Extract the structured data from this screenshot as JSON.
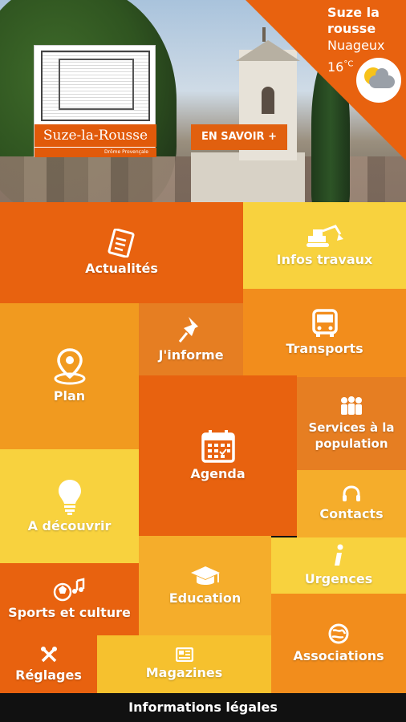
{
  "header": {
    "logo_text": "Suze-la-Rousse",
    "logo_subtext": "Drôme Provençale",
    "more_button": "EN SAVOIR +"
  },
  "weather": {
    "city": "Suze la rousse",
    "condition": "Nuageux",
    "temperature": "16",
    "unit": "°C",
    "icon": "partly-cloudy-icon"
  },
  "tiles": {
    "actualites": "Actualités",
    "infos_travaux": "Infos travaux",
    "j_informe": "J'informe",
    "transports": "Transports",
    "plan": "Plan",
    "services": "Services à la population",
    "agenda": "Agenda",
    "a_decouvrir": "A découvrir",
    "contacts": "Contacts",
    "urgences": "Urgences",
    "education": "Education",
    "sports": "Sports et culture",
    "associations": "Associations",
    "reglages": "Réglages",
    "magazines": "Magazines"
  },
  "footer": {
    "legal": "Informations légales"
  },
  "colors": {
    "orange_dark": "#e8620f",
    "yellow": "#f8d23e",
    "orange": "#f19a1f"
  }
}
